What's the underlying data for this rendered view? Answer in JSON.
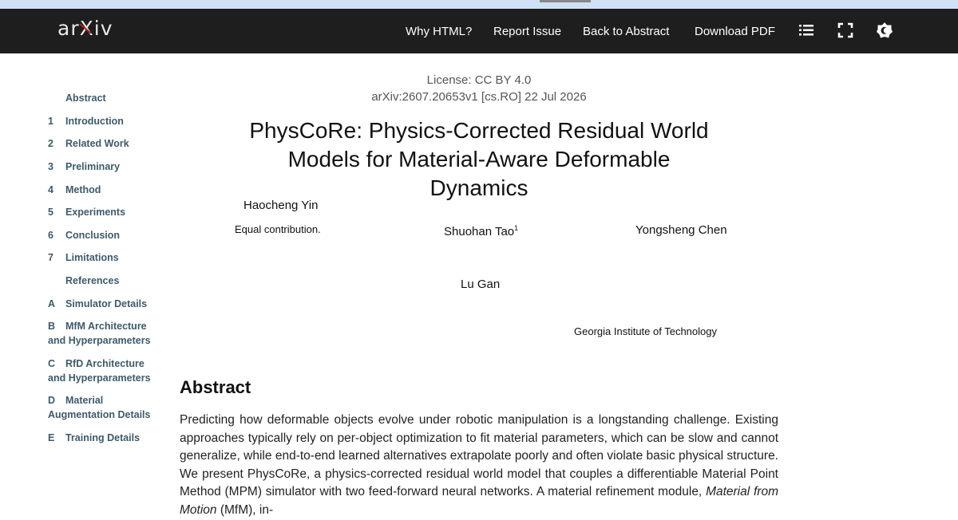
{
  "colors": {
    "navbar": "#1e1e1e",
    "toc_link": "#3d5a6b",
    "logo_accent": "#b31b1b"
  },
  "navbar": {
    "logo": "arXiv",
    "links": [
      "Why HTML?",
      "Report Issue",
      "Back to Abstract",
      "Download PDF"
    ],
    "icons": [
      "list-icon",
      "fullscreen-icon",
      "settings-icon"
    ]
  },
  "toc": [
    {
      "num": "",
      "label": "Abstract"
    },
    {
      "num": "1",
      "label": "Introduction"
    },
    {
      "num": "2",
      "label": "Related Work"
    },
    {
      "num": "3",
      "label": "Preliminary"
    },
    {
      "num": "4",
      "label": "Method"
    },
    {
      "num": "5",
      "label": "Experiments"
    },
    {
      "num": "6",
      "label": "Conclusion"
    },
    {
      "num": "7",
      "label": "Limitations"
    },
    {
      "num": "",
      "label": "References"
    },
    {
      "num": "A",
      "label": "Simulator Details"
    },
    {
      "num": "B",
      "label": "MfM Architecture and Hyperparameters"
    },
    {
      "num": "C",
      "label": "RfD Architecture and Hyperparameters"
    },
    {
      "num": "D",
      "label": "Material Augmentation Details"
    },
    {
      "num": "E",
      "label": "Training Details"
    }
  ],
  "paper": {
    "license": "License: CC BY 4.0",
    "arxiv_id": "arXiv:2607.20653v1 [cs.RO] 22 Jul 2026",
    "title_line1": "PhysCoRe: Physics-Corrected Residual World",
    "title_line2": "Models for Material-Aware Deformable Dynamics",
    "authors": {
      "a1": "Haocheng Yin",
      "a1_note": "Equal contribution.",
      "a2": "Shuohan Tao",
      "a2_sup": "1",
      "a3": "Yongsheng Chen",
      "a4": "Lu Gan",
      "affiliation": "Georgia Institute of Technology"
    },
    "abstract_heading": "Abstract",
    "abstract_part1": "Predicting how deformable objects evolve under robotic manipulation is a longstanding challenge. Existing approaches typically rely on per-object optimization to fit material parameters, which can be slow and cannot generalize, while end-to-end learned alternatives extrapolate poorly and often violate basic physical structure. We present PhysCoRe, a physics-corrected residual world model that couples a differentiable Material Point Method (MPM) simulator with two feed-forward neural networks. A material refinement module, ",
    "abstract_em": "Material from Motion",
    "abstract_part2": " (MfM), in-"
  }
}
